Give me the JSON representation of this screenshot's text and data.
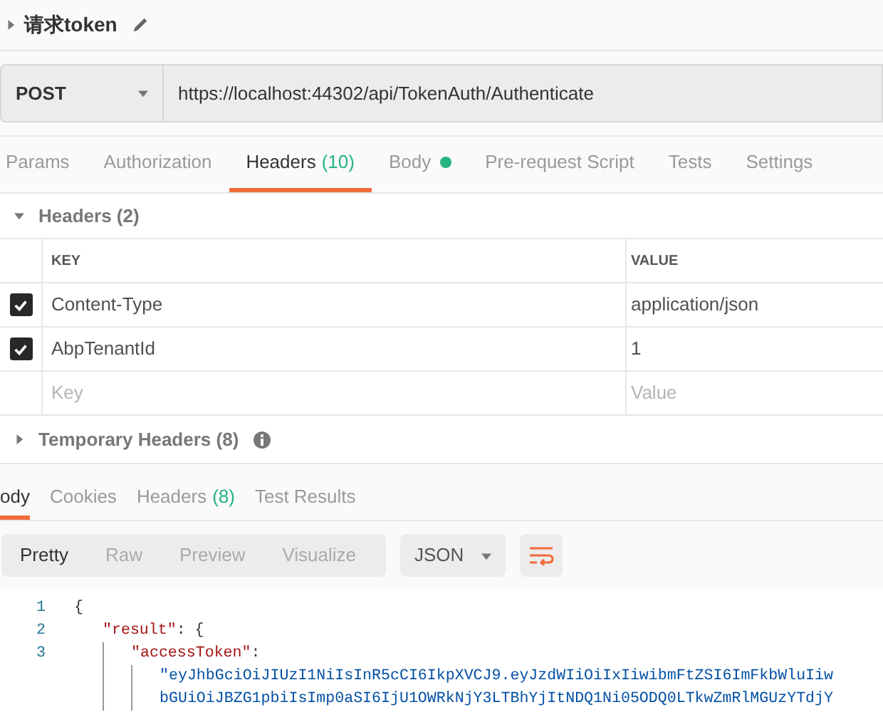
{
  "request": {
    "name": "请求token",
    "expanded": false
  },
  "method": "POST",
  "url": "https://localhost:44302/api/TokenAuth/Authenticate",
  "tabs": [
    {
      "label": "Params",
      "selected": false
    },
    {
      "label": "Authorization",
      "selected": false
    },
    {
      "label": "Headers",
      "count": "(10)",
      "selected": true
    },
    {
      "label": "Body",
      "dot": true,
      "selected": false
    },
    {
      "label": "Pre-request Script",
      "selected": false
    },
    {
      "label": "Tests",
      "selected": false
    },
    {
      "label": "Settings",
      "selected": false
    }
  ],
  "headers_section": {
    "title": "Headers (2)",
    "expanded": true
  },
  "table": {
    "columns": [
      "KEY",
      "VALUE"
    ],
    "rows": [
      {
        "key": "Content-Type",
        "value": "application/json",
        "checked": true
      },
      {
        "key": "AbpTenantId",
        "value": "1",
        "checked": true
      }
    ],
    "new_row": {
      "key_placeholder": "Key",
      "value_placeholder": "Value"
    }
  },
  "temporary_headers": {
    "title": "Temporary Headers (8)",
    "expanded": false
  },
  "response_tabs": [
    {
      "label": "ody",
      "selected": true
    },
    {
      "label": "Cookies",
      "selected": false
    },
    {
      "label": "Headers",
      "count": "(8)",
      "selected": false
    },
    {
      "label": "Test Results",
      "selected": false
    }
  ],
  "view_modes": [
    {
      "label": "Pretty",
      "selected": true
    },
    {
      "label": "Raw",
      "selected": false
    },
    {
      "label": "Preview",
      "selected": false
    },
    {
      "label": "Visualize",
      "selected": false
    }
  ],
  "format": "JSON",
  "code_lines": [
    {
      "number": "1",
      "parts": [
        {
          "kind": "punct",
          "text": "{"
        }
      ],
      "children": [
        {
          "number": "2",
          "parts": [
            {
              "kind": "key",
              "text": "\"result\""
            },
            {
              "kind": "punct",
              "text": ": {"
            }
          ],
          "children": [
            {
              "number": "3",
              "parts": [
                {
                  "kind": "key",
                  "text": "\"accessToken\""
                },
                {
                  "kind": "punct",
                  "text": ":"
                }
              ],
              "children": [
                {
                  "parts": [
                    {
                      "kind": "string",
                      "text": "\"eyJhbGciOiJIUzI1NiIsInR5cCI6IkpXVCJ9.eyJzdWIiOiIxIiwibmFtZSI6ImFkbWluIiw"
                    }
                  ]
                },
                {
                  "parts": [
                    {
                      "kind": "string",
                      "text": "bGUiOiJBZG1pbiIsImp0aSI6IjU1OWRkNjY3LTBhYjItNDQ1Ni05ODQ0LTkwZmRlMGUzYTdjY"
                    }
                  ]
                }
              ]
            }
          ]
        }
      ]
    }
  ]
}
